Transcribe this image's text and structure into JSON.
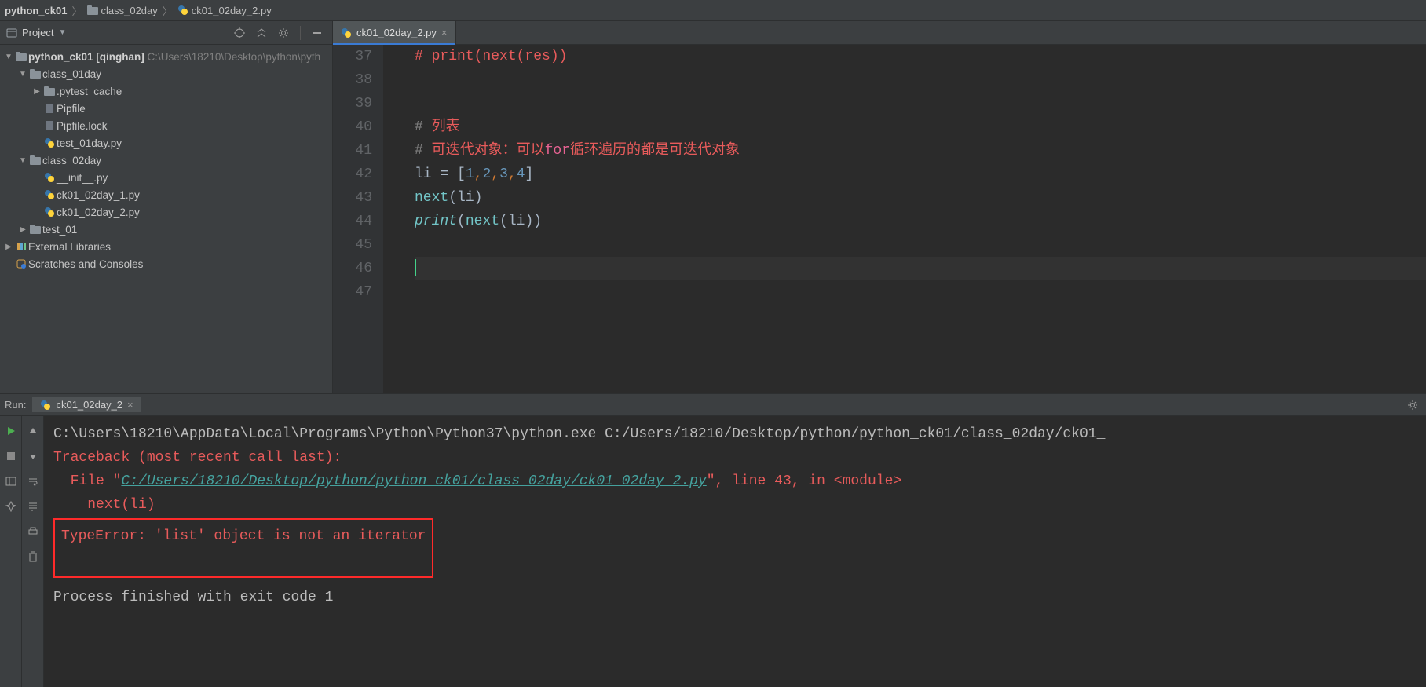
{
  "breadcrumb": {
    "items": [
      "python_ck01",
      "class_02day",
      "ck01_02day_2.py"
    ]
  },
  "sidebar": {
    "title": "Project",
    "root": {
      "name": "python_ck01",
      "tag": "[qinghan]",
      "path": "C:\\Users\\18210\\Desktop\\python\\pyth"
    },
    "items": [
      {
        "name": "class_01day",
        "expanded": true,
        "kind": "folder"
      },
      {
        "name": ".pytest_cache",
        "expanded": false,
        "kind": "folder",
        "indent": 2,
        "arrowRight": true
      },
      {
        "name": "Pipfile",
        "kind": "file",
        "indent": 2
      },
      {
        "name": "Pipfile.lock",
        "kind": "file",
        "indent": 2
      },
      {
        "name": "test_01day.py",
        "kind": "py",
        "indent": 2
      },
      {
        "name": "class_02day",
        "expanded": true,
        "kind": "folder"
      },
      {
        "name": "__init__.py",
        "kind": "py",
        "indent": 2
      },
      {
        "name": "ck01_02day_1.py",
        "kind": "py",
        "indent": 2
      },
      {
        "name": "ck01_02day_2.py",
        "kind": "py",
        "indent": 2
      },
      {
        "name": "test_01",
        "kind": "folder",
        "indent": 1,
        "arrowRight": true
      },
      {
        "name": "External Libraries",
        "kind": "lib",
        "indent": 0,
        "arrowRight": true
      },
      {
        "name": "Scratches and Consoles",
        "kind": "scratch",
        "indent": 0
      }
    ]
  },
  "editor": {
    "tab": "ck01_02day_2.py",
    "lineStart": 37,
    "lineEnd": 47,
    "currentLine": 46
  },
  "code": {
    "l37": "# print(next(res))",
    "l40a": "# ",
    "l40b": "列表",
    "l41a": "# ",
    "l41b": "可迭代对象：可以",
    "l41c": "for",
    "l41d": "循环遍历的都是可迭代对象",
    "l42a": "li ",
    "l42b": "=",
    "l42c": " [",
    "l42d1": "1",
    "l42d2": "2",
    "l42d3": "3",
    "l42d4": "4",
    "l42e": "]",
    "l43a": "next",
    "l43b": "(li)",
    "l44a": "print",
    "l44b": "(",
    "l44c": "next",
    "l44d": "(li))"
  },
  "run": {
    "label": "Run:",
    "tabName": "ck01_02day_2",
    "lines": {
      "cmd": "C:\\Users\\18210\\AppData\\Local\\Programs\\Python\\Python37\\python.exe C:/Users/18210/Desktop/python/python_ck01/class_02day/ck01_",
      "trace": "Traceback (most recent call last):",
      "file1a": "  File \"",
      "file1link": "C:/Users/18210/Desktop/python/python_ck01/class_02day/ck01_02day_2.py",
      "file1b": "\", line 43, in <module>",
      "callline": "    next(li)",
      "error": "TypeError: 'list' object is not an iterator",
      "exit": "Process finished with exit code 1"
    }
  }
}
